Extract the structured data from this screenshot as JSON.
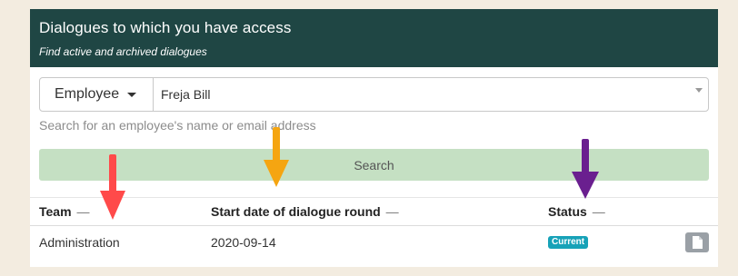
{
  "header": {
    "title": "Dialogues to which you have access",
    "subtitle": "Find active and archived dialogues"
  },
  "search": {
    "type_label": "Employee",
    "employee_value": "Freja Bill",
    "hint": "Search for an employee's name or email address",
    "button_label": "Search"
  },
  "table": {
    "columns": [
      {
        "label": "Team",
        "sort": "—"
      },
      {
        "label": "Start date of dialogue round",
        "sort": "—"
      },
      {
        "label": "Status",
        "sort": "—"
      }
    ],
    "rows": [
      {
        "team": "Administration",
        "start_date": "2020-09-14",
        "status": "Current"
      }
    ]
  },
  "colors": {
    "header_bg": "#1f4644",
    "search_button_bg": "#c5e0c3",
    "status_badge_bg": "#17a2b8",
    "arrow_red": "#ff4a4a",
    "arrow_orange": "#f5a511",
    "arrow_purple": "#6a1f8f"
  },
  "icons": {
    "type_dropdown": "caret-down-icon",
    "employee_dropdown": "caret-down-icon",
    "row_action": "document-icon",
    "annotation_arrows": "arrow-down-icon"
  }
}
